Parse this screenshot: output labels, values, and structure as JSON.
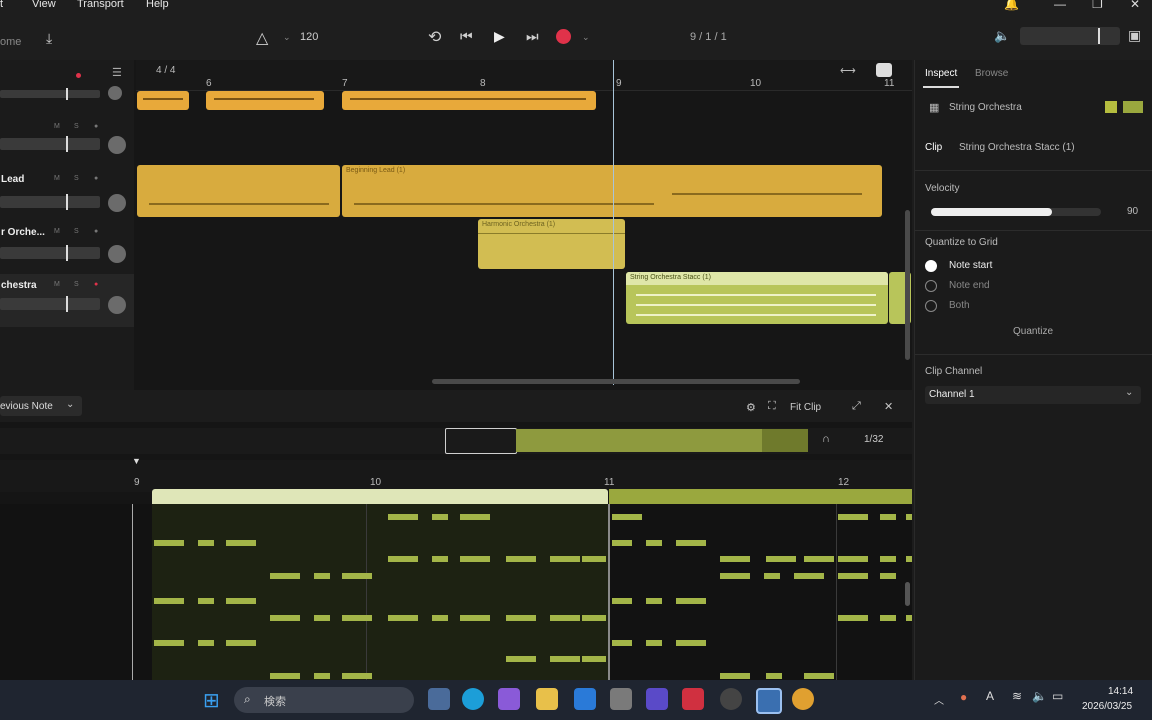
{
  "menu": {
    "items": [
      "t",
      "View",
      "Transport",
      "Help"
    ]
  },
  "toolbar": {
    "tempo": "120",
    "position": "9 / 1 / 1",
    "left_label": "ome"
  },
  "arrangement": {
    "time_signature": "4 / 4",
    "ruler_ticks": [
      "6",
      "7",
      "8",
      "9",
      "10",
      "11"
    ],
    "tracks": [
      {
        "name": ""
      },
      {
        "name": ""
      },
      {
        "name": "Lead"
      },
      {
        "name": "r Orche..."
      },
      {
        "name": "chestra"
      }
    ],
    "clips": [
      {
        "label": ""
      },
      {
        "label": "Beginning Lead (1)"
      },
      {
        "label": "Harmonic Orchestra (1)"
      },
      {
        "label": "String Orchestra Stacc (1)"
      }
    ]
  },
  "editor": {
    "previous_note_label": "evious Note",
    "fit_clip_label": "Fit Clip",
    "quantize_value": "1/32",
    "ruler_ticks": [
      "9",
      "10",
      "11",
      "12"
    ]
  },
  "inspector": {
    "tabs": [
      "Inspect",
      "Browse"
    ],
    "track_name": "String Orchestra",
    "clip_label": "Clip",
    "clip_name": "String Orchestra Stacc (1)",
    "velocity_label": "Velocity",
    "velocity_value": "90",
    "velocity_fraction": 0.71,
    "quantize_label": "Quantize to Grid",
    "options": [
      "Note start",
      "Note end",
      "Both"
    ],
    "selected_option": "Note start",
    "quantize_button": "Quantize",
    "channel_label": "Clip Channel",
    "channel_value": "Channel 1"
  },
  "taskbar": {
    "search_placeholder": "検索",
    "time": "14:14",
    "date": "2026/03/25"
  },
  "colors": {
    "accent_orange": "#e8a93a",
    "accent_gold": "#d8ab3e",
    "accent_olive": "#a3b548",
    "record_red": "#e0324a",
    "panel_bg": "#1b1b1b"
  }
}
